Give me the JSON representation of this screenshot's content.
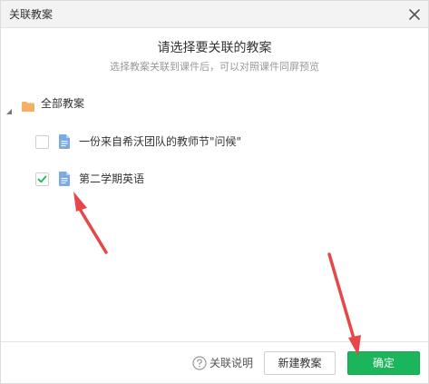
{
  "dialog": {
    "title": "关联教案",
    "heading": "请选择要关联的教案",
    "subheading": "选择教案关联到课件后，可以对照课件同屏预览"
  },
  "tree": {
    "root_label": "全部教案",
    "items": [
      {
        "label": "一份来自希沃团队的教师节\"问候\"",
        "checked": false
      },
      {
        "label": "第二学期英语",
        "checked": true
      }
    ]
  },
  "footer": {
    "help_label": "关联说明",
    "new_button": "新建教案",
    "ok_button": "确定"
  },
  "colors": {
    "accent": "#1bb55c",
    "arrow": "#e8474a",
    "folder": "#f5b062",
    "doc": "#7aa9e8",
    "checkmark": "#1bb55c"
  },
  "icons": [
    "close-icon",
    "caret-down-icon",
    "folder-icon",
    "document-icon",
    "checkmark-icon",
    "question-circle-icon",
    "annotation-arrow"
  ]
}
